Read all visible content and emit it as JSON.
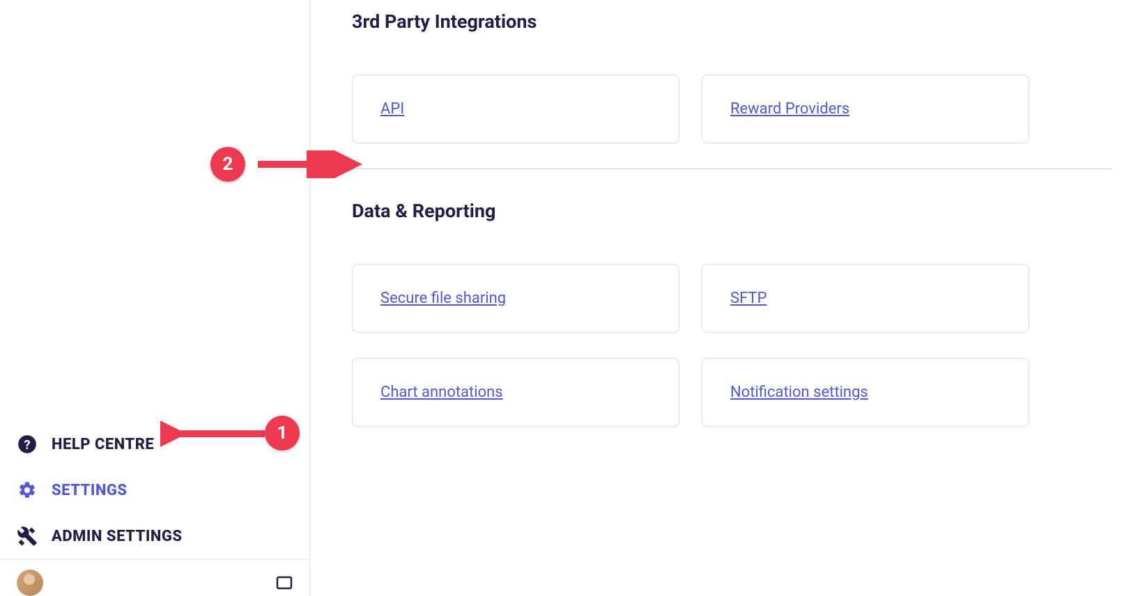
{
  "sidebar": {
    "help_centre": "HELP CENTRE",
    "settings": "SETTINGS",
    "admin_settings": "ADMIN SETTINGS"
  },
  "main": {
    "sections": [
      {
        "title": "3rd Party Integrations",
        "cards": [
          {
            "label": "API"
          },
          {
            "label": "Reward Providers"
          }
        ]
      },
      {
        "title": "Data & Reporting",
        "cards": [
          {
            "label": "Secure file sharing"
          },
          {
            "label": "SFTP"
          },
          {
            "label": "Chart annotations"
          },
          {
            "label": "Notification settings"
          }
        ]
      }
    ]
  },
  "annotations": {
    "badge1": "1",
    "badge2": "2"
  },
  "colors": {
    "accent": "#4f58d6",
    "text_dark": "#241b47",
    "annotation": "#ee3a50"
  }
}
